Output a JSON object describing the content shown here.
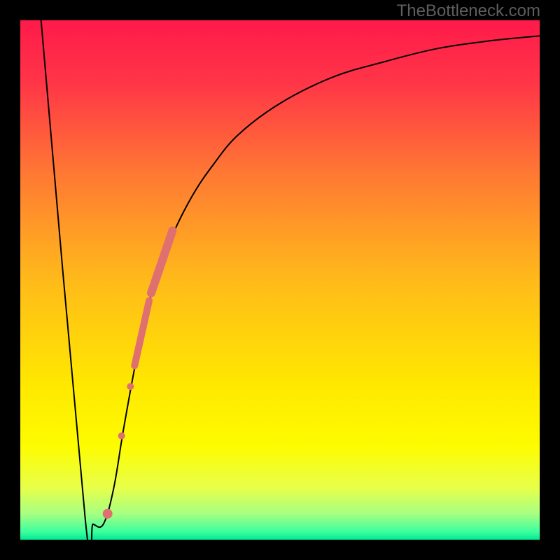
{
  "watermark": "TheBottleneck.com",
  "chart_data": {
    "type": "line",
    "title": "",
    "xlabel": "",
    "ylabel": "",
    "xlim": [
      0,
      100
    ],
    "ylim": [
      0,
      100
    ],
    "background": {
      "type": "vertical-gradient",
      "stops": [
        {
          "pos": 0.0,
          "color": "#ff1a4a"
        },
        {
          "pos": 0.12,
          "color": "#ff3547"
        },
        {
          "pos": 0.3,
          "color": "#ff7a33"
        },
        {
          "pos": 0.5,
          "color": "#ffba1a"
        },
        {
          "pos": 0.7,
          "color": "#ffe800"
        },
        {
          "pos": 0.82,
          "color": "#fdfc00"
        },
        {
          "pos": 0.9,
          "color": "#e8ff4a"
        },
        {
          "pos": 0.95,
          "color": "#a7ff82"
        },
        {
          "pos": 0.985,
          "color": "#3cff9e"
        },
        {
          "pos": 1.0,
          "color": "#00e893"
        }
      ]
    },
    "series": [
      {
        "name": "curve",
        "stroke": "#000000",
        "values_xy": [
          [
            4,
            100
          ],
          [
            12.5,
            4
          ],
          [
            14,
            3
          ],
          [
            16,
            3
          ],
          [
            18,
            10
          ],
          [
            20,
            22
          ],
          [
            23,
            38
          ],
          [
            26,
            50
          ],
          [
            29,
            58
          ],
          [
            33,
            66
          ],
          [
            37,
            72
          ],
          [
            42,
            78
          ],
          [
            50,
            84
          ],
          [
            60,
            89
          ],
          [
            70,
            92
          ],
          [
            80,
            94.5
          ],
          [
            90,
            96
          ],
          [
            100,
            97
          ]
        ]
      }
    ],
    "markers": [
      {
        "name": "segment-upper",
        "kind": "thick-segment",
        "color": "#e07070",
        "x1": 25.2,
        "y1": 47.5,
        "x2": 29.3,
        "y2": 59.5,
        "width": 12
      },
      {
        "name": "segment-mid",
        "kind": "thick-segment",
        "color": "#e07070",
        "x1": 22.0,
        "y1": 33.5,
        "x2": 24.8,
        "y2": 46.0,
        "width": 10
      },
      {
        "name": "dot-a",
        "kind": "dot",
        "color": "#e07070",
        "x": 21.2,
        "y": 29.5,
        "r": 5
      },
      {
        "name": "dot-b",
        "kind": "dot",
        "color": "#e07070",
        "x": 19.5,
        "y": 20.0,
        "r": 5
      },
      {
        "name": "dot-c",
        "kind": "dot",
        "color": "#e07070",
        "x": 16.8,
        "y": 5.0,
        "r": 7
      }
    ]
  }
}
